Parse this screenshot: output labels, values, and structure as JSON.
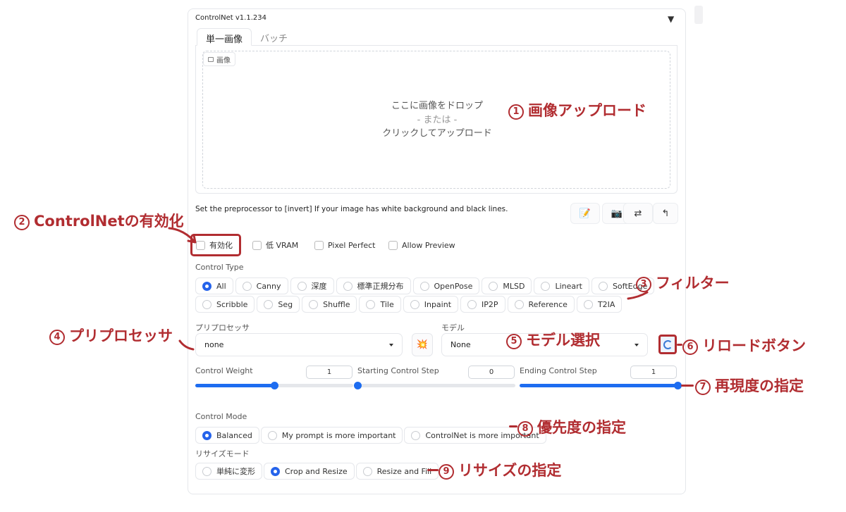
{
  "panel": {
    "title": "ControlNet v1.1.234",
    "collapse_icon": "▼"
  },
  "tabs": [
    {
      "label": "単一画像",
      "active": true
    },
    {
      "label": "バッチ",
      "active": false
    }
  ],
  "upload": {
    "image_label": "画像",
    "line1": "ここに画像をドロップ",
    "line2": "- または -",
    "line3": "クリックしてアップロード"
  },
  "note": "Set the preprocessor to [invert] If your image has white background and black lines.",
  "tool_buttons": [
    {
      "icon": "edit-icon",
      "glyph": "📝"
    },
    {
      "icon": "camera-icon",
      "glyph": "📷"
    },
    {
      "icon": "swap-icon",
      "glyph": "⇄"
    },
    {
      "icon": "send-up-icon",
      "glyph": "↰"
    }
  ],
  "checkboxes": [
    {
      "label": "有効化",
      "checked": false
    },
    {
      "label": "低 VRAM",
      "checked": false
    },
    {
      "label": "Pixel Perfect",
      "checked": false
    },
    {
      "label": "Allow Preview",
      "checked": false
    }
  ],
  "control_type": {
    "label": "Control Type",
    "options": [
      "All",
      "Canny",
      "深度",
      "標準正規分布",
      "OpenPose",
      "MLSD",
      "Lineart",
      "SoftEdge",
      "Scribble",
      "Seg",
      "Shuffle",
      "Tile",
      "Inpaint",
      "IP2P",
      "Reference",
      "T2IA"
    ],
    "selected": "All"
  },
  "preprocessor": {
    "label": "プリプロセッサ",
    "value": "none",
    "run_icon": "💥"
  },
  "model": {
    "label": "モデル",
    "value": "None"
  },
  "sliders": [
    {
      "label": "Control Weight",
      "value": "1",
      "fraction": 0.5
    },
    {
      "label": "Starting Control Step",
      "value": "0",
      "fraction": 0.0
    },
    {
      "label": "Ending Control Step",
      "value": "1",
      "fraction": 1.0
    }
  ],
  "control_mode": {
    "label": "Control Mode",
    "options": [
      "Balanced",
      "My prompt is more important",
      "ControlNet is more important"
    ],
    "selected": "Balanced"
  },
  "resize_mode": {
    "label": "リサイズモード",
    "options": [
      "単純に変形",
      "Crop and Resize",
      "Resize and Fill"
    ],
    "selected": "Crop and Resize"
  },
  "annotations": {
    "a1": {
      "num": "1",
      "text": "画像アップロード"
    },
    "a2": {
      "num": "2",
      "text": "ControlNetの有効化"
    },
    "a3": {
      "num": "3",
      "text": "フィルター"
    },
    "a4": {
      "num": "4",
      "text": "プリプロセッサ"
    },
    "a5": {
      "num": "5",
      "text": "モデル選択"
    },
    "a6": {
      "num": "6",
      "text": "リロードボタン"
    },
    "a7": {
      "num": "7",
      "text": "再現度の指定"
    },
    "a8": {
      "num": "8",
      "text": "優先度の指定"
    },
    "a9": {
      "num": "9",
      "text": "リサイズの指定"
    }
  },
  "colors": {
    "accent": "#2563eb",
    "annotation": "#b12d31"
  }
}
